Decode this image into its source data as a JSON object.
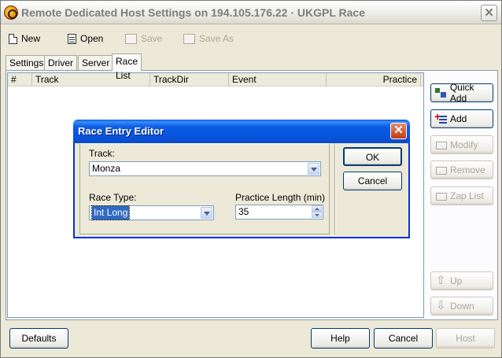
{
  "window": {
    "title": "Remote Dedicated Host Settings on 194.105.176.22 · UKGPL Race",
    "close": "✕"
  },
  "toolbar": {
    "new_label": "New",
    "open_label": "Open",
    "save_label": "Save",
    "saveas_label": "Save As"
  },
  "tabs": [
    "Settings",
    "Driver",
    "Server",
    "Race List"
  ],
  "active_tab": "Race List",
  "race_list": {
    "columns": [
      "#",
      "Track",
      "TrackDir",
      "Event",
      "Practice"
    ],
    "rows": []
  },
  "side_buttons": {
    "quick_add": "Quick Add",
    "add": "Add",
    "modify": "Modify",
    "remove": "Remove",
    "zap_list": "Zap List",
    "up": "Up",
    "down": "Down"
  },
  "bottom": {
    "defaults": "Defaults",
    "help": "Help",
    "cancel": "Cancel",
    "host": "Host"
  },
  "dialog": {
    "title": "Race Entry Editor",
    "close": "✕",
    "track_label": "Track:",
    "track_value": "Monza",
    "race_type_label": "Race Type:",
    "race_type_value": "Int Long",
    "practice_label": "Practice Length (min)",
    "practice_value": "35",
    "ok": "OK",
    "cancel": "Cancel"
  }
}
